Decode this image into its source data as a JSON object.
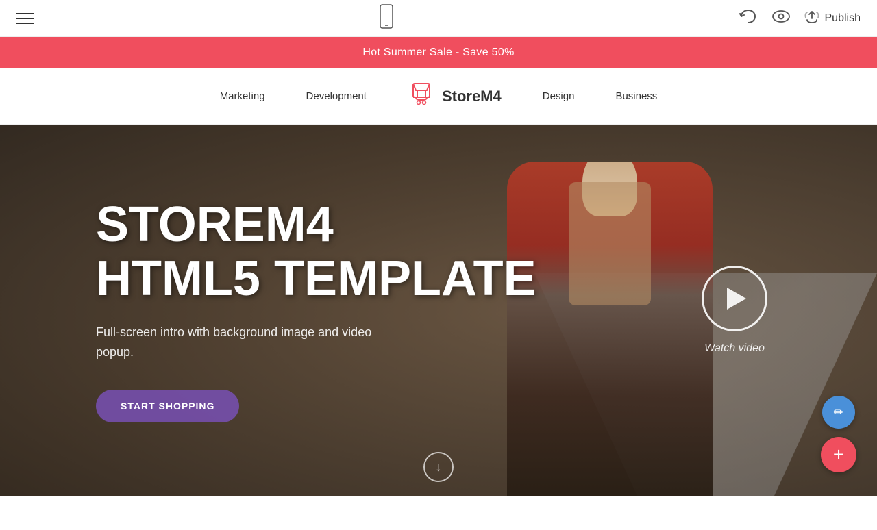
{
  "toolbar": {
    "hamburger_label": "menu",
    "publish_label": "Publish",
    "undo_icon": "undo",
    "eye_icon": "preview",
    "upload_icon": "upload"
  },
  "sale_banner": {
    "text": "Hot Summer Sale - Save 50%"
  },
  "nav": {
    "logo_text": "StoreM4",
    "items": [
      {
        "label": "Marketing",
        "id": "marketing"
      },
      {
        "label": "Development",
        "id": "development"
      },
      {
        "label": "Design",
        "id": "design"
      },
      {
        "label": "Business",
        "id": "business"
      }
    ]
  },
  "hero": {
    "title_line1": "STOREM4",
    "title_line2": "HTML5 TEMPLATE",
    "subtitle": "Full-screen intro with background image and video\npopup.",
    "cta_label": "START SHOPPING",
    "watch_video_label": "Watch video",
    "scroll_arrow": "↓"
  },
  "fab": {
    "edit_icon": "✏",
    "add_icon": "+"
  }
}
